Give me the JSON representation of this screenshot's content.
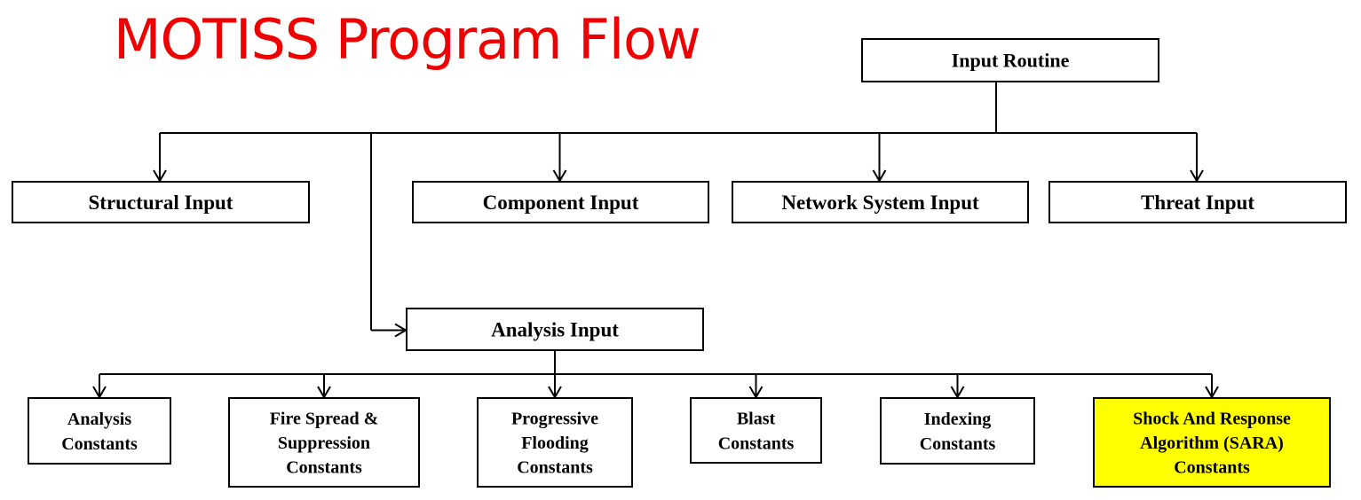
{
  "title": "MOTISS Program Flow",
  "colors": {
    "title": "#ee0000",
    "highlight": "#ffff00",
    "box_border": "#000000"
  },
  "nodes": {
    "input_routine": {
      "label": [
        "Input Routine"
      ]
    },
    "structural_input": {
      "label": [
        "Structural Input"
      ]
    },
    "component_input": {
      "label": [
        "Component Input"
      ]
    },
    "network_system_input": {
      "label": [
        "Network System Input"
      ]
    },
    "threat_input": {
      "label": [
        "Threat Input"
      ]
    },
    "analysis_input": {
      "label": [
        "Analysis Input"
      ]
    },
    "analysis_constants": {
      "label": [
        "Analysis",
        "Constants"
      ]
    },
    "fire_spread_constants": {
      "label": [
        "Fire Spread &",
        "Suppression",
        "Constants"
      ]
    },
    "progressive_flooding_constants": {
      "label": [
        "Progressive",
        "Flooding",
        "Constants"
      ]
    },
    "blast_constants": {
      "label": [
        "Blast",
        "Constants"
      ]
    },
    "indexing_constants": {
      "label": [
        "Indexing",
        "Constants"
      ]
    },
    "sara_constants": {
      "label": [
        "Shock And Response",
        "Algorithm (SARA)",
        "Constants"
      ],
      "highlighted": true
    }
  },
  "edges": [
    {
      "from": "input_routine",
      "to": "structural_input"
    },
    {
      "from": "input_routine",
      "to": "component_input"
    },
    {
      "from": "input_routine",
      "to": "network_system_input"
    },
    {
      "from": "input_routine",
      "to": "threat_input"
    },
    {
      "from": "input_routine",
      "to": "analysis_input"
    },
    {
      "from": "analysis_input",
      "to": "analysis_constants"
    },
    {
      "from": "analysis_input",
      "to": "fire_spread_constants"
    },
    {
      "from": "analysis_input",
      "to": "progressive_flooding_constants"
    },
    {
      "from": "analysis_input",
      "to": "blast_constants"
    },
    {
      "from": "analysis_input",
      "to": "indexing_constants"
    },
    {
      "from": "analysis_input",
      "to": "sara_constants"
    }
  ]
}
